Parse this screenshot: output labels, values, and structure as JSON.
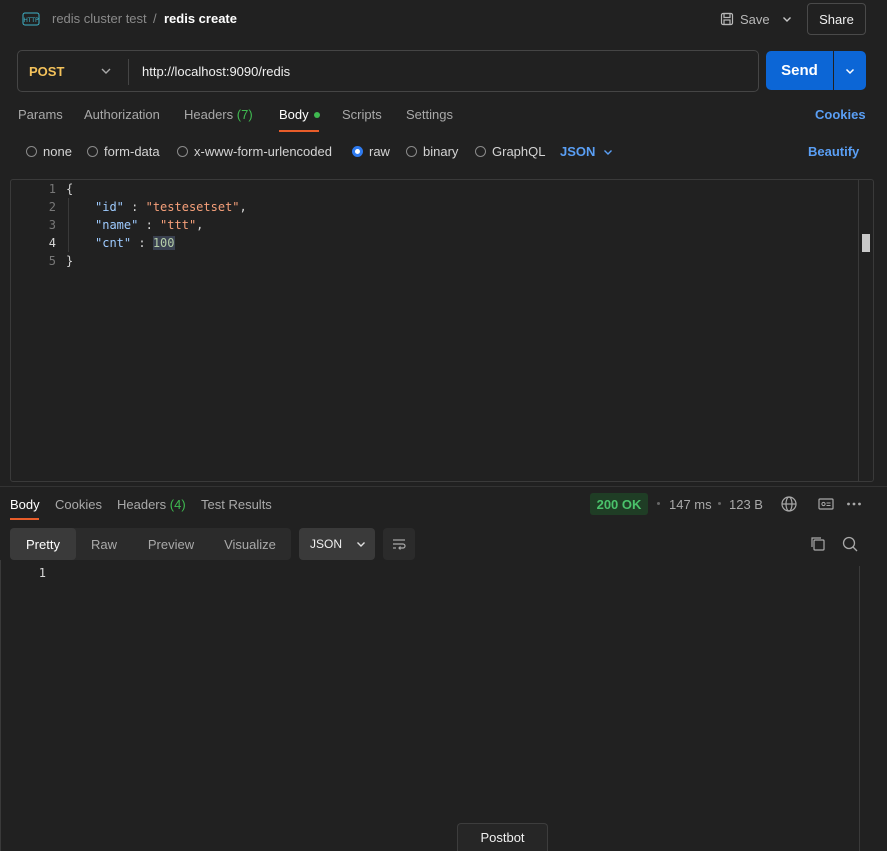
{
  "header": {
    "breadcrumb_parent": "redis cluster test",
    "breadcrumb_separator": "/",
    "breadcrumb_current": "redis create",
    "save_label": "Save",
    "share_label": "Share",
    "icon": "http-icon"
  },
  "request": {
    "method": "POST",
    "url": "http://localhost:9090/redis",
    "send_label": "Send"
  },
  "tabs": {
    "params": "Params",
    "authorization": "Authorization",
    "headers": "Headers",
    "headers_count": "(7)",
    "body": "Body",
    "scripts": "Scripts",
    "settings": "Settings",
    "active": "Body",
    "cookies": "Cookies"
  },
  "body_types": {
    "none": "none",
    "form_data": "form-data",
    "urlencoded": "x-www-form-urlencoded",
    "raw": "raw",
    "binary": "binary",
    "graphql": "GraphQL",
    "selected": "raw",
    "format": "JSON",
    "beautify": "Beautify"
  },
  "editor": {
    "line_numbers": [
      "1",
      "2",
      "3",
      "4",
      "5"
    ],
    "active_line": "4",
    "lines": {
      "l1": "{",
      "l2_key": "\"id\"",
      "l2_sep": " : ",
      "l2_val": "\"testesetset\"",
      "l2_end": ",",
      "l3_key": "\"name\"",
      "l3_sep": " : ",
      "l3_val": "\"ttt\"",
      "l3_end": ",",
      "l4_key": "\"cnt\"",
      "l4_sep": " : ",
      "l4_val": "100",
      "l5": "}"
    }
  },
  "response": {
    "tabs": {
      "body": "Body",
      "cookies": "Cookies",
      "headers": "Headers",
      "headers_count": "(4)",
      "test_results": "Test Results"
    },
    "status": "200 OK",
    "time": "147 ms",
    "size": "123 B",
    "views": {
      "pretty": "Pretty",
      "raw": "Raw",
      "preview": "Preview",
      "visualize": "Visualize",
      "active": "Pretty"
    },
    "format": "JSON",
    "line_numbers": [
      "1"
    ]
  },
  "footer": {
    "postbot": "Postbot"
  },
  "colors": {
    "background": "#212121",
    "accent_blue": "#0c66d6",
    "link_blue": "#5a9ff5",
    "method_yellow": "#f4c25b",
    "tab_underline": "#e85d2a",
    "status_green": "#4ac26b"
  }
}
